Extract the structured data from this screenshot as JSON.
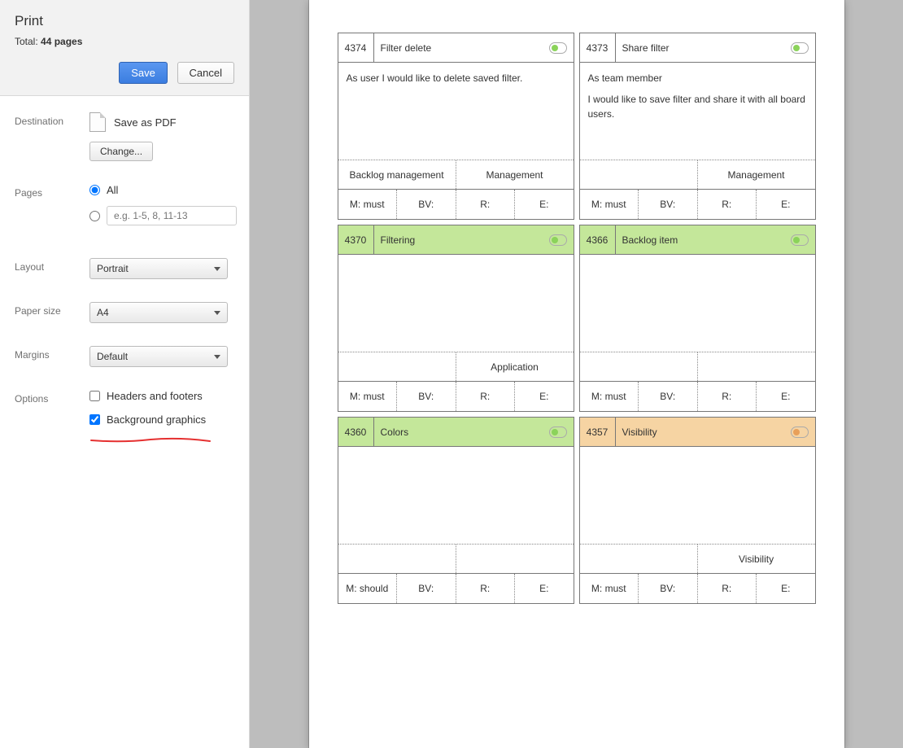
{
  "print": {
    "title": "Print",
    "total_prefix": "Total: ",
    "total_count": "44 pages",
    "save_label": "Save",
    "cancel_label": "Cancel"
  },
  "destination": {
    "label": "Destination",
    "name": "Save as PDF",
    "change": "Change..."
  },
  "pages": {
    "label": "Pages",
    "all": "All",
    "range_placeholder": "e.g. 1-5, 8, 11-13"
  },
  "layout": {
    "label": "Layout",
    "value": "Portrait"
  },
  "paper": {
    "label": "Paper size",
    "value": "A4"
  },
  "margins": {
    "label": "Margins",
    "value": "Default"
  },
  "options": {
    "label": "Options",
    "headers": "Headers and footers",
    "background": "Background graphics"
  },
  "cards": [
    {
      "id": "4374",
      "title": "Filter delete",
      "header_class": "",
      "toggle": "green",
      "body": [
        "As user I would like to delete saved filter."
      ],
      "tags": [
        "Backlog management",
        "Management"
      ],
      "footer": [
        "M: must",
        "BV:",
        "R:",
        "E:"
      ]
    },
    {
      "id": "4373",
      "title": "Share filter",
      "header_class": "",
      "toggle": "green",
      "body": [
        "As team member",
        "I would like to save filter and share it with all board users."
      ],
      "tags": [
        "",
        "Management"
      ],
      "footer": [
        "M: must",
        "BV:",
        "R:",
        "E:"
      ]
    },
    {
      "id": "4370",
      "title": "Filtering",
      "header_class": "hdr-green",
      "toggle": "green",
      "body": [],
      "tags": [
        "",
        "Application"
      ],
      "footer": [
        "M: must",
        "BV:",
        "R:",
        "E:"
      ]
    },
    {
      "id": "4366",
      "title": "Backlog item",
      "header_class": "hdr-green",
      "toggle": "green",
      "body": [],
      "tags": [
        "",
        ""
      ],
      "footer": [
        "M: must",
        "BV:",
        "R:",
        "E:"
      ]
    },
    {
      "id": "4360",
      "title": "Colors",
      "header_class": "hdr-green",
      "toggle": "green",
      "body": [],
      "tags": [
        "",
        ""
      ],
      "footer": [
        "M: should",
        "BV:",
        "R:",
        "E:"
      ]
    },
    {
      "id": "4357",
      "title": "Visibility",
      "header_class": "hdr-orange",
      "toggle": "orange",
      "body": [],
      "tags": [
        "",
        "Visibility"
      ],
      "footer": [
        "M: must",
        "BV:",
        "R:",
        "E:"
      ]
    }
  ]
}
